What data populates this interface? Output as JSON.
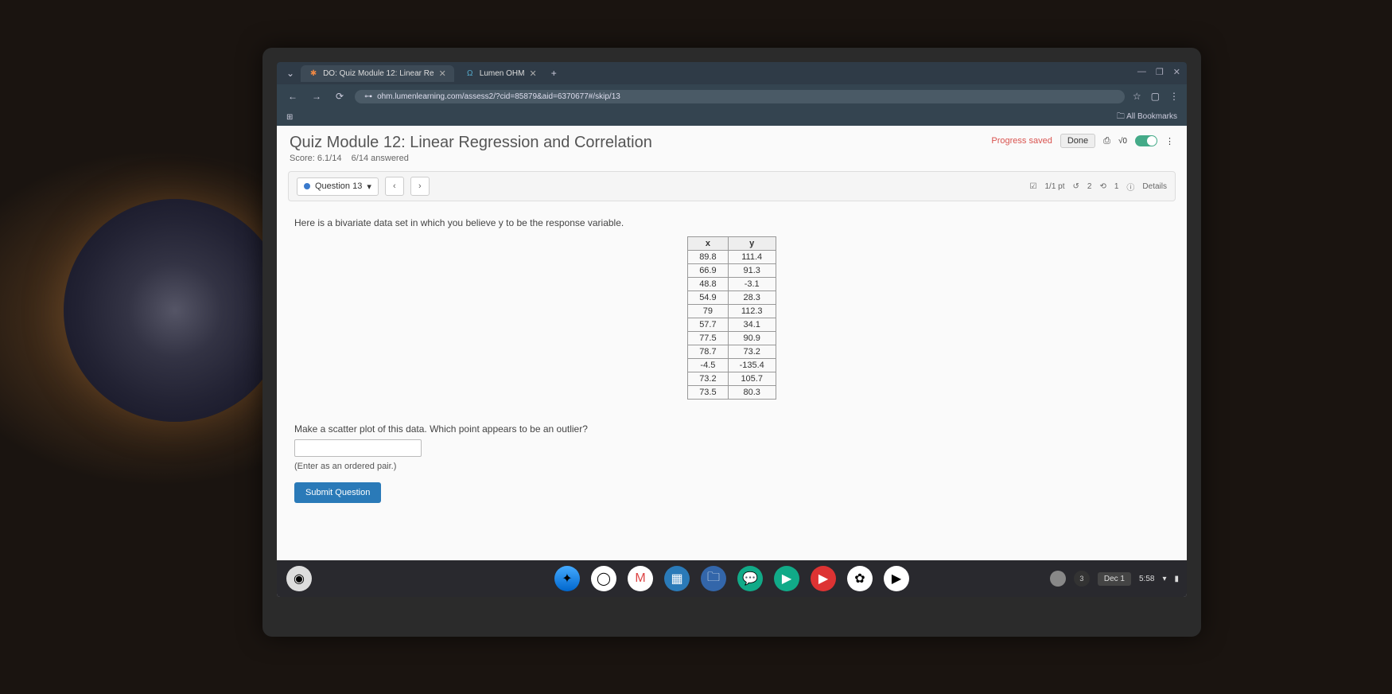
{
  "browser": {
    "tabs": [
      {
        "icon": "●",
        "label": "DO: Quiz Module 12: Linear Re",
        "color": "#e84"
      },
      {
        "icon": "Ω",
        "label": "Lumen OHM",
        "color": "#5ac"
      }
    ],
    "url": "ohm.lumenlearning.com/assess2/?cid=85879&aid=6370677#/skip/13",
    "bookmarks_label": "All Bookmarks"
  },
  "quiz": {
    "title": "Quiz Module 12: Linear Regression and Correlation",
    "score": "Score: 6.1/14",
    "answered": "6/14 answered",
    "progress_saved": "Progress saved",
    "done": "Done",
    "question_label": "Question 13",
    "points": "1/1 pt",
    "attempts": "2",
    "retries": "1",
    "details": "Details",
    "prompt": "Here is a bivariate data set in which you believe y to be the response variable.",
    "table": {
      "headers": [
        "x",
        "y"
      ],
      "rows": [
        [
          "89.8",
          "111.4"
        ],
        [
          "66.9",
          "91.3"
        ],
        [
          "48.8",
          "-3.1"
        ],
        [
          "54.9",
          "28.3"
        ],
        [
          "79",
          "112.3"
        ],
        [
          "57.7",
          "34.1"
        ],
        [
          "77.5",
          "90.9"
        ],
        [
          "78.7",
          "73.2"
        ],
        [
          "-4.5",
          "-135.4"
        ],
        [
          "73.2",
          "105.7"
        ],
        [
          "73.5",
          "80.3"
        ]
      ]
    },
    "question2": "Make a scatter plot of this data. Which point appears to be an outlier?",
    "hint": "(Enter as an ordered pair.)",
    "submit": "Submit Question"
  },
  "shelf": {
    "date": "Dec 1",
    "time": "5:58"
  }
}
